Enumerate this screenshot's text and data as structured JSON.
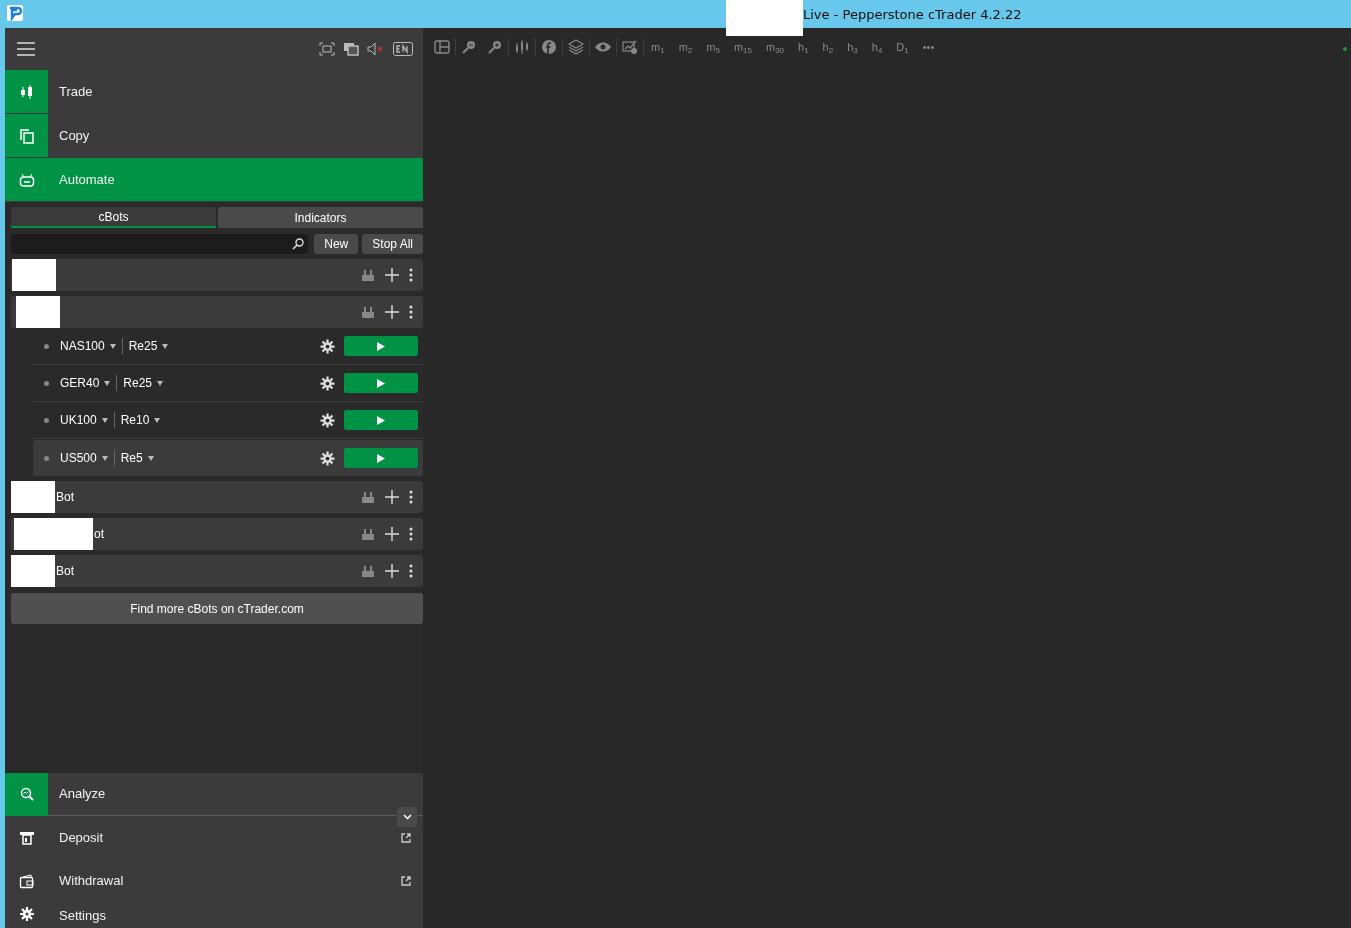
{
  "window": {
    "title": "Live - Pepperstone cTrader 4.2.22"
  },
  "sidebar": {
    "nav": [
      {
        "label": "Trade",
        "kind": "trade",
        "selected": false
      },
      {
        "label": "Copy",
        "kind": "copy",
        "selected": false
      },
      {
        "label": "Automate",
        "kind": "automate",
        "selected": true
      }
    ],
    "tabs": [
      {
        "label": "cBots",
        "selected": true
      },
      {
        "label": "Indicators",
        "selected": false
      }
    ],
    "buttons": [
      "New",
      "Stop All"
    ],
    "bots": [
      {
        "redacted": true
      },
      {
        "redacted": true,
        "instances": [
          {
            "symbol": "NAS100",
            "timeframe": "Re25",
            "selected": false
          },
          {
            "symbol": "GER40",
            "timeframe": "Re25",
            "selected": false
          },
          {
            "symbol": "UK100",
            "timeframe": "Re10",
            "selected": false
          },
          {
            "symbol": "US500",
            "timeframe": "Re5",
            "selected": true
          }
        ]
      },
      {
        "name": "Bot",
        "redacted": true
      },
      {
        "name": "ot",
        "redacted": true
      },
      {
        "name": "Bot",
        "redacted": true
      }
    ],
    "find_more": "Find more cBots on cTrader.com",
    "bottom_nav": [
      {
        "label": "Analyze",
        "kind": "analyze",
        "external": false
      },
      {
        "label": "Deposit",
        "kind": "deposit",
        "external": true
      },
      {
        "label": "Withdrawal",
        "kind": "withdrawal",
        "external": true
      },
      {
        "label": "Settings",
        "kind": "settings",
        "external": false
      }
    ]
  },
  "chart_toolbar": {
    "timeframes": [
      "m$_{1}$",
      "m$_{2}$",
      "m$_{5}$",
      "m$_{15}$",
      "m$_{30}$",
      "h$_{1}$",
      "h$_{2}$",
      "h$_{3}$",
      "h$_{4}$",
      "D$_{1}$"
    ],
    "more": "•••"
  }
}
